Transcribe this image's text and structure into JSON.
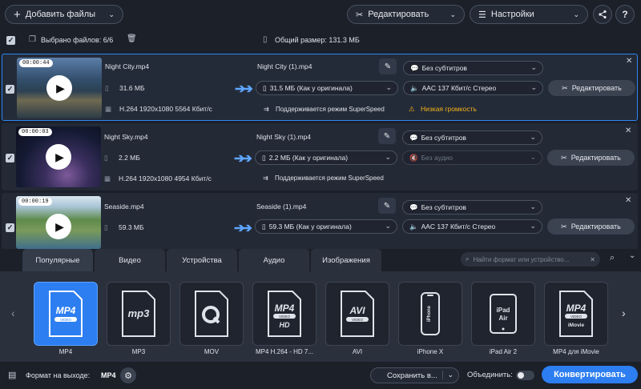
{
  "toolbar": {
    "add_files_label": "Добавить файлы",
    "edit_label": "Редактировать",
    "settings_label": "Настройки"
  },
  "selection": {
    "selected_label": "Выбрано файлов: 6/6",
    "total_size_label": "Общий размер: 131.3 МБ"
  },
  "files": [
    {
      "duration": "00:00:44",
      "input_name": "Night City.mp4",
      "input_size": "31.6 МБ",
      "input_info": "H.264 1920x1080 5564 Кбит/с",
      "output_name": "Night City (1).mp4",
      "output_size": "31.5 МБ (Как у оригинала)",
      "superspeed": "Поддерживается режим SuperSpeed",
      "subtitles": "Без субтитров",
      "audio": "AAC 137 Кбит/с Стерео",
      "warning": "Низкая громкость",
      "edit_label": "Редактировать"
    },
    {
      "duration": "00:00:03",
      "input_name": "Night Sky.mp4",
      "input_size": "2.2 МБ",
      "input_info": "H.264 1920x1080 4954 Кбит/с",
      "output_name": "Night Sky (1).mp4",
      "output_size": "2.2 МБ (Как у оригинала)",
      "superspeed": "Поддерживается режим SuperSpeed",
      "subtitles": "Без субтитров",
      "audio": "Без аудио",
      "warning": "",
      "edit_label": "Редактировать"
    },
    {
      "duration": "00:00:19",
      "input_name": "Seaside.mp4",
      "input_size": "59.3 МБ",
      "input_info": "",
      "output_name": "Seaside (1).mp4",
      "output_size": "59.3 МБ (Как у оригинала)",
      "superspeed": "",
      "subtitles": "Без субтитров",
      "audio": "AAC 137 Кбит/с Стерео",
      "warning": "",
      "edit_label": "Редактировать"
    }
  ],
  "tabs": [
    "Популярные",
    "Видео",
    "Устройства",
    "Аудио",
    "Изображения"
  ],
  "search": {
    "placeholder": "Найти формат или устройство..."
  },
  "formats": [
    {
      "label": "MP4",
      "icon": "mp4-icon"
    },
    {
      "label": "MP3",
      "icon": "mp3-icon"
    },
    {
      "label": "MOV",
      "icon": "mov-icon"
    },
    {
      "label": "MP4 H.264 - HD 7...",
      "icon": "mp4-hd-icon"
    },
    {
      "label": "AVI",
      "icon": "avi-icon"
    },
    {
      "label": "iPhone X",
      "icon": "iphone-icon"
    },
    {
      "label": "iPad Air 2",
      "icon": "ipad-icon"
    },
    {
      "label": "MP4 для iMovie",
      "icon": "mp4-imovie-icon"
    }
  ],
  "format_icons_text": {
    "mp4": "MP4",
    "video": "VIDEO",
    "mp3": "mp3",
    "hd": "HD",
    "avi": "AVI",
    "iphone": "iPhone",
    "ipad": "iPad",
    "air": "Air",
    "imovie": "iMovie"
  },
  "bottom": {
    "output_format_label": "Формат на выходе:",
    "output_format_value": "MP4",
    "save_label": "Сохранить в...",
    "merge_label": "Объединить:",
    "convert_label": "Конвертировать"
  },
  "colors": {
    "accent": "#2d7ef0",
    "warning": "#f2b21b",
    "background": "#1a1f29"
  }
}
